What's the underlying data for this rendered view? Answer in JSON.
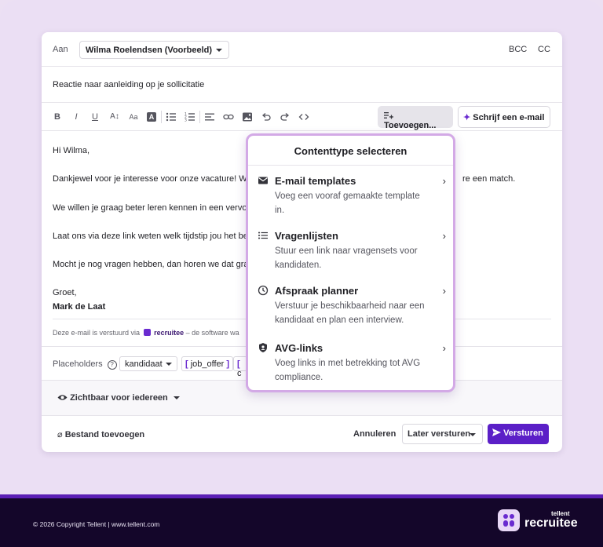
{
  "composer": {
    "to_label": "Aan",
    "to_value": "Wilma Roelendsen (Voorbeeld)",
    "bcc": "BCC",
    "cc": "CC",
    "subject": "Reactie naar aanleiding op je sollicitatie"
  },
  "toolbar": {
    "bold": "B",
    "italic": "I",
    "underline": "U",
    "font_size": "A↕",
    "font_case": "Aa",
    "text_color": "A",
    "add_button": "Toevoegen...",
    "ai_button": "Schrijf een e-mail"
  },
  "body": {
    "greeting": "Hi Wilma,",
    "line1_start": "Dankjewel voor je interesse voor onze vacature!  We",
    "line1_end": "re een match.",
    "line2": "We willen je graag beter leren kennen in een vervolg",
    "line3": "Laat ons via deze link weten welk  tijdstip jou het be",
    "line4": "Mocht je nog vragen hebben, dan horen we dat graa",
    "regards": "Groet,",
    "sender": "Mark de Laat",
    "sig_prefix": "Deze e-mail is verstuurd via",
    "sig_brand": "recruitee",
    "sig_suffix": "– de software wa"
  },
  "placeholders": {
    "label": "Placeholders",
    "help": "?",
    "select_value": "kandidaat",
    "chip1_open": "[",
    "chip1_text": " job_offer ",
    "chip1_close": "]",
    "chip2_open": "[",
    "chip2_text": " c"
  },
  "visibility": {
    "label": "Zichtbaar voor iedereen"
  },
  "footer_actions": {
    "attach": "Bestand toevoegen",
    "cancel": "Annuleren",
    "later": "Later versturen",
    "send": "Versturen"
  },
  "popup": {
    "title": "Contenttype selecteren",
    "items": [
      {
        "title": "E-mail templates",
        "desc": "Voeg een vooraf gemaakte template in."
      },
      {
        "title": "Vragenlijsten",
        "desc": "Stuur een link naar vragensets voor kandidaten."
      },
      {
        "title": "Afspraak planner",
        "desc": "Verstuur je beschikbaarheid naar een kandidaat en plan een interview."
      },
      {
        "title": "AVG-links",
        "desc": "Voeg links in met betrekking tot AVG compliance."
      }
    ]
  },
  "page_footer": {
    "copyright": "© 2026 Copyright Tellent | www.tellent.com",
    "logo_small": "tellent",
    "logo_big": "recruitee"
  },
  "colors": {
    "accent": "#5b1fc7",
    "popup_border": "#d3a9e6",
    "background": "#ebdff4",
    "footer_bg": "#14062a"
  }
}
